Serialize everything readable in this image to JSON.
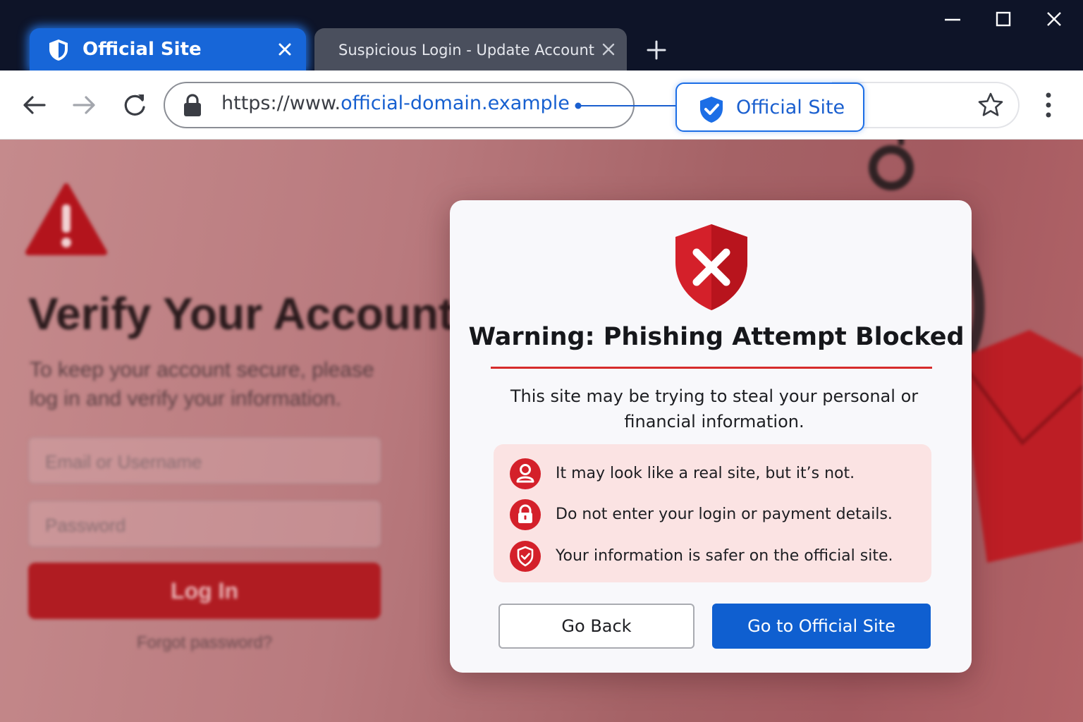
{
  "tabs": [
    {
      "title": "Official Site",
      "active": true,
      "icon": "shield-icon",
      "close_icon": "close-icon"
    },
    {
      "title": "Suspicious Login - Update Account",
      "active": false,
      "close_icon": "close-icon"
    }
  ],
  "window_controls": [
    "minimize-icon",
    "maximize-icon",
    "close-icon"
  ],
  "toolbar": {
    "back_icon": "arrow-left-icon",
    "forward_icon": "arrow-right-icon",
    "reload_icon": "reload-icon",
    "url_prefix": "https://www.",
    "url_host": "official-domain.example",
    "site_badge_label": "Official Site",
    "bookmark_icon": "star-icon",
    "menu_icon": "kebab-menu-icon"
  },
  "background_page": {
    "title": "Verify Your Account",
    "subtitle": "To keep your account secure, please log in and verify your information.",
    "email_placeholder": "Email or Username",
    "password_placeholder": "Password",
    "login_button": "Log In",
    "forgot_link": "Forgot password?"
  },
  "dialog": {
    "title": "Warning: Phishing Attempt Blocked",
    "message": "This site may be trying to steal your personal or financial information.",
    "tips": [
      {
        "icon": "user-icon",
        "text": "It may look like a real site, but it’s not."
      },
      {
        "icon": "lock-icon",
        "text": "Do not enter your login or payment details."
      },
      {
        "icon": "shield-check-icon",
        "text": "Your information is safer on the official site."
      }
    ],
    "back_button": "Go Back",
    "official_button": "Go to Official Site"
  },
  "colors": {
    "accent_blue": "#1766d8",
    "danger_red": "#d62b2b",
    "tips_background": "#fbe3e3",
    "titlebar": "#0e1428"
  }
}
